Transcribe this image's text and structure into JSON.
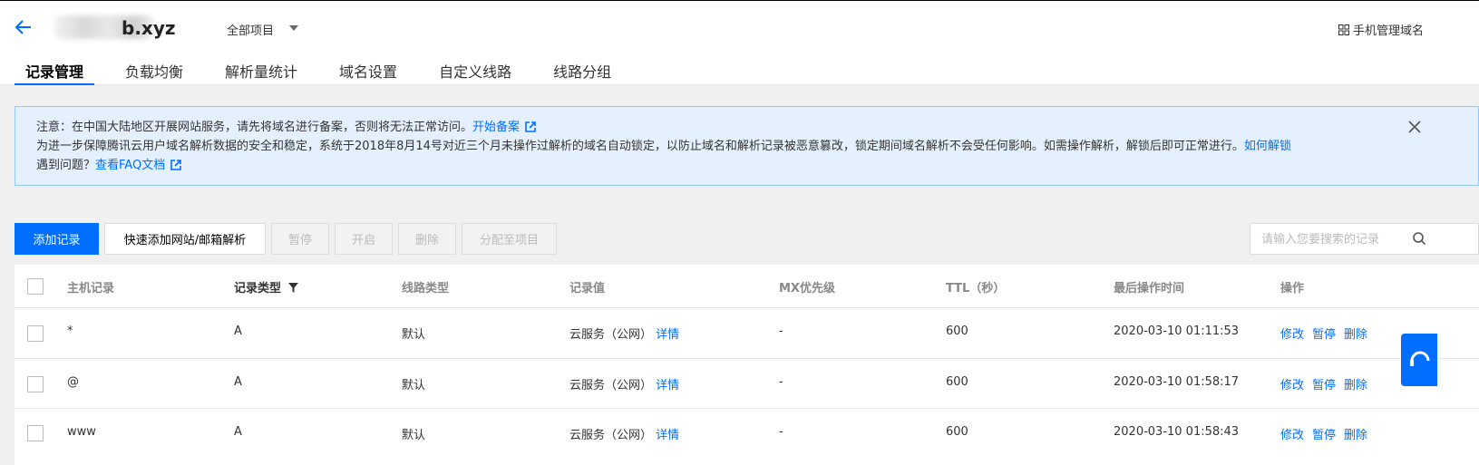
{
  "header": {
    "domain_suffix": "b.xyz",
    "project_select": "全部项目",
    "mobile_link": "手机管理域名"
  },
  "tabs": [
    {
      "label": "记录管理",
      "active": true
    },
    {
      "label": "负载均衡"
    },
    {
      "label": "解析量统计"
    },
    {
      "label": "域名设置"
    },
    {
      "label": "自定义线路"
    },
    {
      "label": "线路分组"
    }
  ],
  "notice": {
    "line1_text": "注意：在中国大陆地区开展网站服务，请先将域名进行备案，否则将无法正常访问。",
    "line1_link": "开始备案",
    "line2_text": "为进一步保障腾讯云用户域名解析数据的安全和稳定，系统于2018年8月14号对近三个月未操作过解析的域名自动锁定，以防止域名和解析记录被恶意篡改，锁定期间域名解析不会受任何影响。如需操作解析，解锁后即可正常进行。",
    "line2_link": "如何解锁",
    "line3_text": "遇到问题？",
    "line3_link": "查看FAQ文档"
  },
  "toolbar": {
    "add": "添加记录",
    "quick_add": "快速添加网站/邮箱解析",
    "pause": "暂停",
    "enable": "开启",
    "delete": "删除",
    "assign": "分配至项目",
    "search_placeholder": "请输入您要搜索的记录"
  },
  "table": {
    "columns": [
      "主机记录",
      "记录类型",
      "线路类型",
      "记录值",
      "MX优先级",
      "TTL（秒）",
      "最后操作时间",
      "操作"
    ],
    "detail_label": "详情",
    "actions": [
      "修改",
      "暂停",
      "删除"
    ],
    "rows": [
      {
        "host": "*",
        "type": "A",
        "line": "默认",
        "value": "云服务（公网）",
        "mx": "-",
        "ttl": "600",
        "time": "2020-03-10 01:11:53"
      },
      {
        "host": "@",
        "type": "A",
        "line": "默认",
        "value": "云服务（公网）",
        "mx": "-",
        "ttl": "600",
        "time": "2020-03-10 01:58:17"
      },
      {
        "host": "www",
        "type": "A",
        "line": "默认",
        "value": "云服务（公网）",
        "mx": "-",
        "ttl": "600",
        "time": "2020-03-10 01:58:43"
      }
    ]
  },
  "colors": {
    "accent": "#006eff",
    "notice_bg": "#e5f0ff",
    "notice_border": "#97c7ff"
  }
}
